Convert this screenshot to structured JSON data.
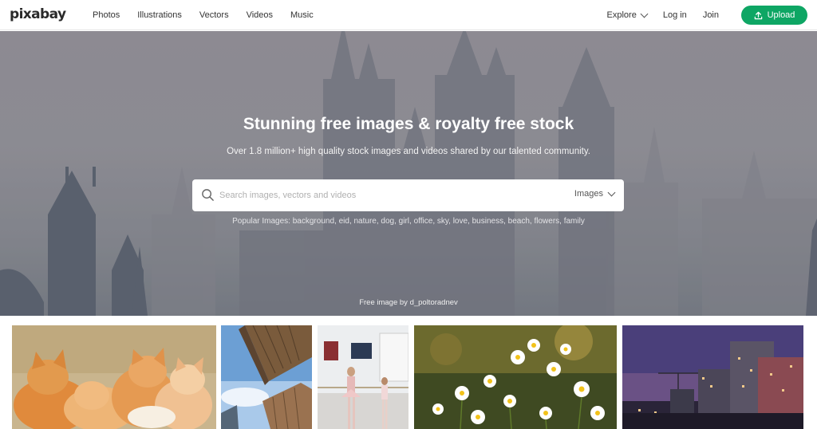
{
  "header": {
    "logo": "pixabay",
    "nav": [
      "Photos",
      "Illustrations",
      "Vectors",
      "Videos",
      "Music"
    ],
    "explore": "Explore",
    "login": "Log in",
    "join": "Join",
    "upload": "Upload"
  },
  "hero": {
    "title": "Stunning free images & royalty free stock",
    "subtitle": "Over 1.8 million+ high quality stock images and videos shared by our talented community.",
    "search_placeholder": "Search images, vectors and videos",
    "search_type": "Images",
    "popular_label": "Popular Images:",
    "popular_tags": [
      "background",
      "eid",
      "nature",
      "dog",
      "girl",
      "office",
      "sky",
      "love",
      "business",
      "beach",
      "flowers",
      "family"
    ],
    "credit": "Free image by d_poltoradnev"
  },
  "colors": {
    "brand": "#0ea664"
  }
}
